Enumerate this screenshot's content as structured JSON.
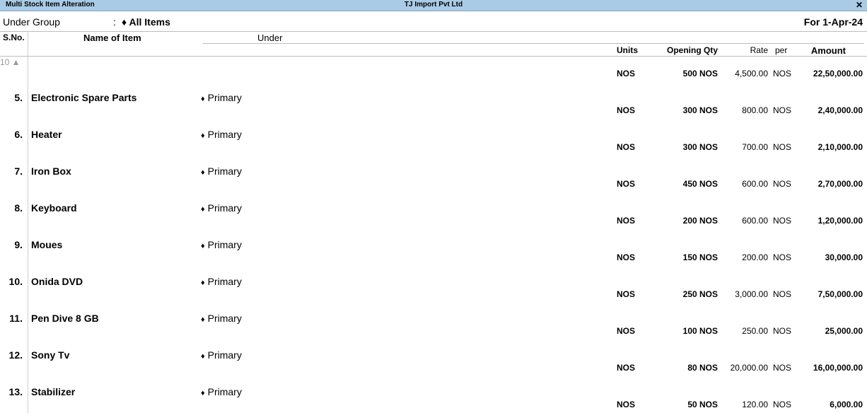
{
  "window": {
    "app_title": "Multi Stock Item  Alteration",
    "company": "TJ Import Pvt Ltd",
    "close_glyph": "✕"
  },
  "filter": {
    "label": "Under Group",
    "colon": ":",
    "value": "♦ All Items",
    "date": "For 1-Apr-24"
  },
  "columns": {
    "sno": "S.No.",
    "name": "Name of Item",
    "under": "Under",
    "units": "Units",
    "opening_qty": "Opening Qty",
    "rate": "Rate",
    "per": "per",
    "amount": "Amount"
  },
  "more_above": "10 ▲",
  "first_row_values": {
    "units": "NOS",
    "qty": "500 NOS",
    "rate": "4,500.00",
    "per": "NOS",
    "amount": "22,50,000.00"
  },
  "items": [
    {
      "sno": "5.",
      "name": "Electronic Spare Parts",
      "under": "Primary",
      "units": "NOS",
      "qty": "300 NOS",
      "rate": "800.00",
      "per": "NOS",
      "amount": "2,40,000.00"
    },
    {
      "sno": "6.",
      "name": "Heater",
      "under": "Primary",
      "units": "NOS",
      "qty": "300 NOS",
      "rate": "700.00",
      "per": "NOS",
      "amount": "2,10,000.00"
    },
    {
      "sno": "7.",
      "name": "Iron Box",
      "under": "Primary",
      "units": "NOS",
      "qty": "450 NOS",
      "rate": "600.00",
      "per": "NOS",
      "amount": "2,70,000.00"
    },
    {
      "sno": "8.",
      "name": "Keyboard",
      "under": "Primary",
      "units": "NOS",
      "qty": "200 NOS",
      "rate": "600.00",
      "per": "NOS",
      "amount": "1,20,000.00"
    },
    {
      "sno": "9.",
      "name": "Moues",
      "under": "Primary",
      "units": "NOS",
      "qty": "150 NOS",
      "rate": "200.00",
      "per": "NOS",
      "amount": "30,000.00"
    },
    {
      "sno": "10.",
      "name": "Onida DVD",
      "under": "Primary",
      "units": "NOS",
      "qty": "250 NOS",
      "rate": "3,000.00",
      "per": "NOS",
      "amount": "7,50,000.00"
    },
    {
      "sno": "11.",
      "name": "Pen Dive 8 GB",
      "under": "Primary",
      "units": "NOS",
      "qty": "100 NOS",
      "rate": "250.00",
      "per": "NOS",
      "amount": "25,000.00"
    },
    {
      "sno": "12.",
      "name": "Sony Tv",
      "under": "Primary",
      "units": "NOS",
      "qty": "80 NOS",
      "rate": "20,000.00",
      "per": "NOS",
      "amount": "16,00,000.00"
    },
    {
      "sno": "13.",
      "name": "Stabilizer",
      "under": "Primary",
      "units": "NOS",
      "qty": "50 NOS",
      "rate": "120.00",
      "per": "NOS",
      "amount": "6,000.00"
    }
  ]
}
